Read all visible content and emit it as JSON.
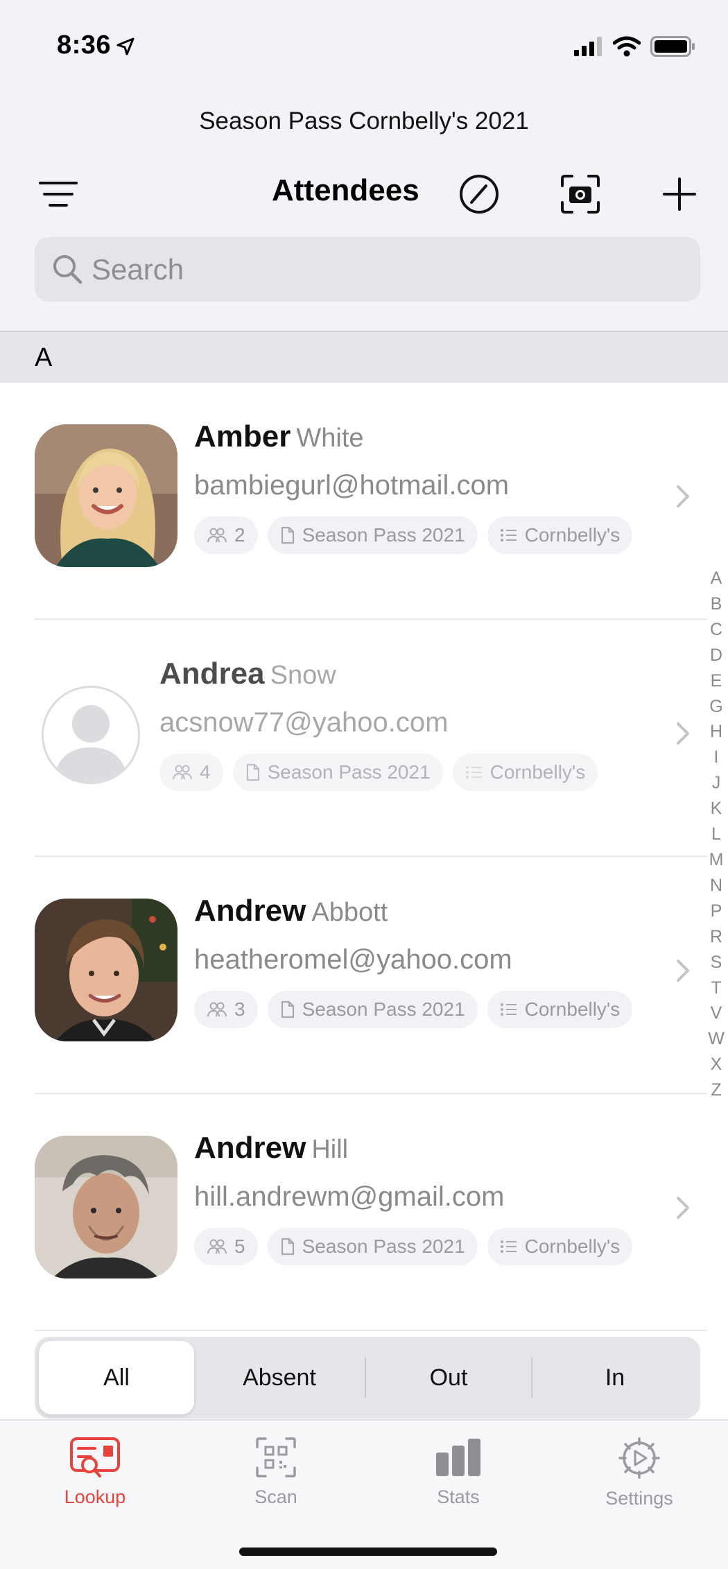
{
  "status_bar": {
    "time": "8:36"
  },
  "header": {
    "subtitle": "Season Pass Cornbelly's 2021",
    "title": "Attendees"
  },
  "search": {
    "placeholder": "Search"
  },
  "section_letter": "A",
  "attendees": [
    {
      "first": "Amber",
      "last": "White",
      "email": "bambiegurl@hotmail.com",
      "count": "2",
      "pass": "Season Pass 2021",
      "list": "Cornbelly's"
    },
    {
      "first": "Andrea",
      "last": "Snow",
      "email": "acsnow77@yahoo.com",
      "count": "4",
      "pass": "Season Pass 2021",
      "list": "Cornbelly's"
    },
    {
      "first": "Andrew",
      "last": "Abbott",
      "email": "heatheromel@yahoo.com",
      "count": "3",
      "pass": "Season Pass 2021",
      "list": "Cornbelly's"
    },
    {
      "first": "Andrew",
      "last": "Hill",
      "email": "hill.andrewm@gmail.com",
      "count": "5",
      "pass": "Season Pass 2021",
      "list": "Cornbelly's"
    }
  ],
  "index_letters": [
    "A",
    "B",
    "C",
    "D",
    "E",
    "G",
    "H",
    "I",
    "J",
    "K",
    "L",
    "M",
    "N",
    "P",
    "R",
    "S",
    "T",
    "V",
    "W",
    "X",
    "Z"
  ],
  "filter": {
    "all": "All",
    "absent": "Absent",
    "out": "Out",
    "in": "In"
  },
  "tabs": {
    "lookup": "Lookup",
    "scan": "Scan",
    "stats": "Stats",
    "settings": "Settings"
  },
  "colors": {
    "accent": "#e8433d",
    "background": "#f2f2f7"
  }
}
